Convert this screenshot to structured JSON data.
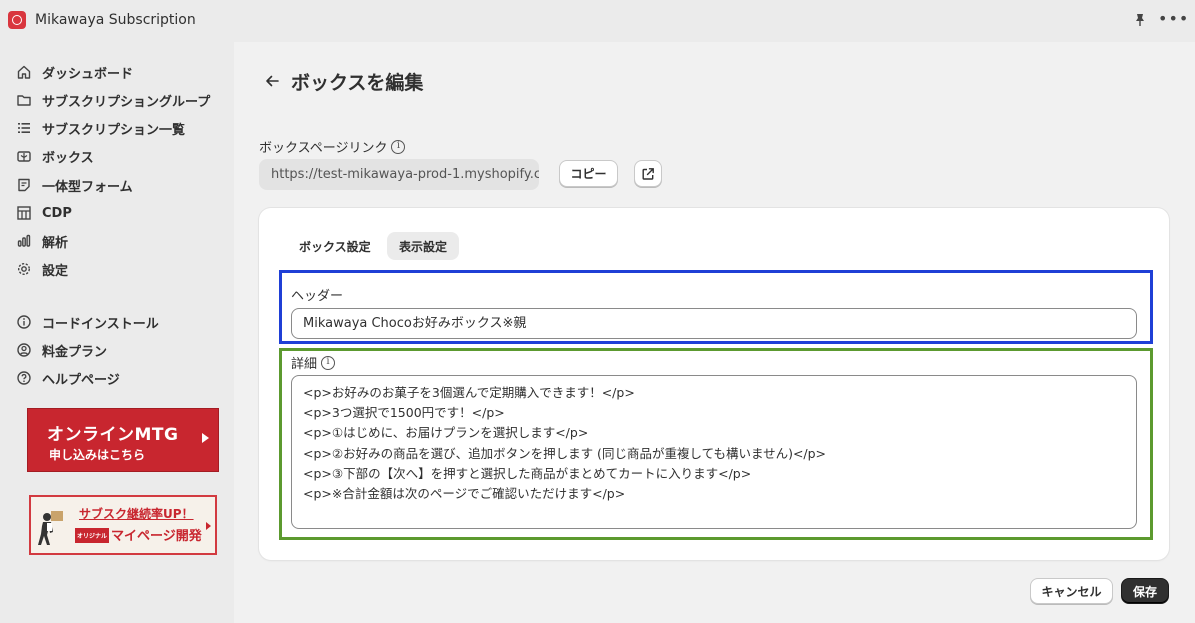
{
  "app": {
    "title": "Mikawaya Subscription"
  },
  "sidebar": {
    "items": [
      {
        "label": "ダッシュボード",
        "icon": "home-icon"
      },
      {
        "label": "サブスクリプショングループ",
        "icon": "folder-icon"
      },
      {
        "label": "サブスクリプション一覧",
        "icon": "list-icon"
      },
      {
        "label": "ボックス",
        "icon": "gift-icon"
      },
      {
        "label": "一体型フォーム",
        "icon": "form-icon"
      },
      {
        "label": "CDP",
        "icon": "grid-icon"
      },
      {
        "label": "解析",
        "icon": "bar-chart-icon"
      },
      {
        "label": "設定",
        "icon": "gear-icon"
      },
      {
        "label": "コードインストール",
        "icon": "info-circle-icon"
      },
      {
        "label": "料金プラン",
        "icon": "user-circle-icon"
      },
      {
        "label": "ヘルプページ",
        "icon": "question-circle-icon"
      }
    ],
    "banner_mtg": {
      "line1": "オンラインMTG",
      "line2": "申し込みはこちら"
    },
    "banner_sub": {
      "line1": "サブスク継続率UP！",
      "tag": "オリジナル",
      "line2": "マイページ開発"
    }
  },
  "page": {
    "title": "ボックスを編集"
  },
  "box_link": {
    "label": "ボックスページリンク",
    "url": "https://test-mikawaya-prod-1.myshopify.c",
    "copy_label": "コピー"
  },
  "tabs": [
    {
      "label": "ボックス設定",
      "active": false
    },
    {
      "label": "表示設定",
      "active": true
    }
  ],
  "header_field": {
    "label": "ヘッダー",
    "value": "Mikawaya Chocoお好みボックス※親"
  },
  "detail_field": {
    "label": "詳細",
    "lines": [
      "<p>お好みのお菓子を3個選んで定期購入できます！</p>",
      "<p>3つ選択で1500円です！</p>",
      "<p>①はじめに、お届けプランを選択します</p>",
      "<p>②お好みの商品を選び、追加ボタンを押します (同じ商品が重複しても構いません)</p>",
      "<p>③下部の【次へ】を押すと選択した商品がまとめてカートに入ります</p>",
      "<p>※合計金額は次のページでご確認いただけます</p>"
    ]
  },
  "actions": {
    "cancel_label": "キャンセル",
    "save_label": "保存"
  },
  "colors": {
    "highlight_blue": "#1f3fd6",
    "highlight_green": "#5c9a2f",
    "brand_red": "#c8262f"
  }
}
